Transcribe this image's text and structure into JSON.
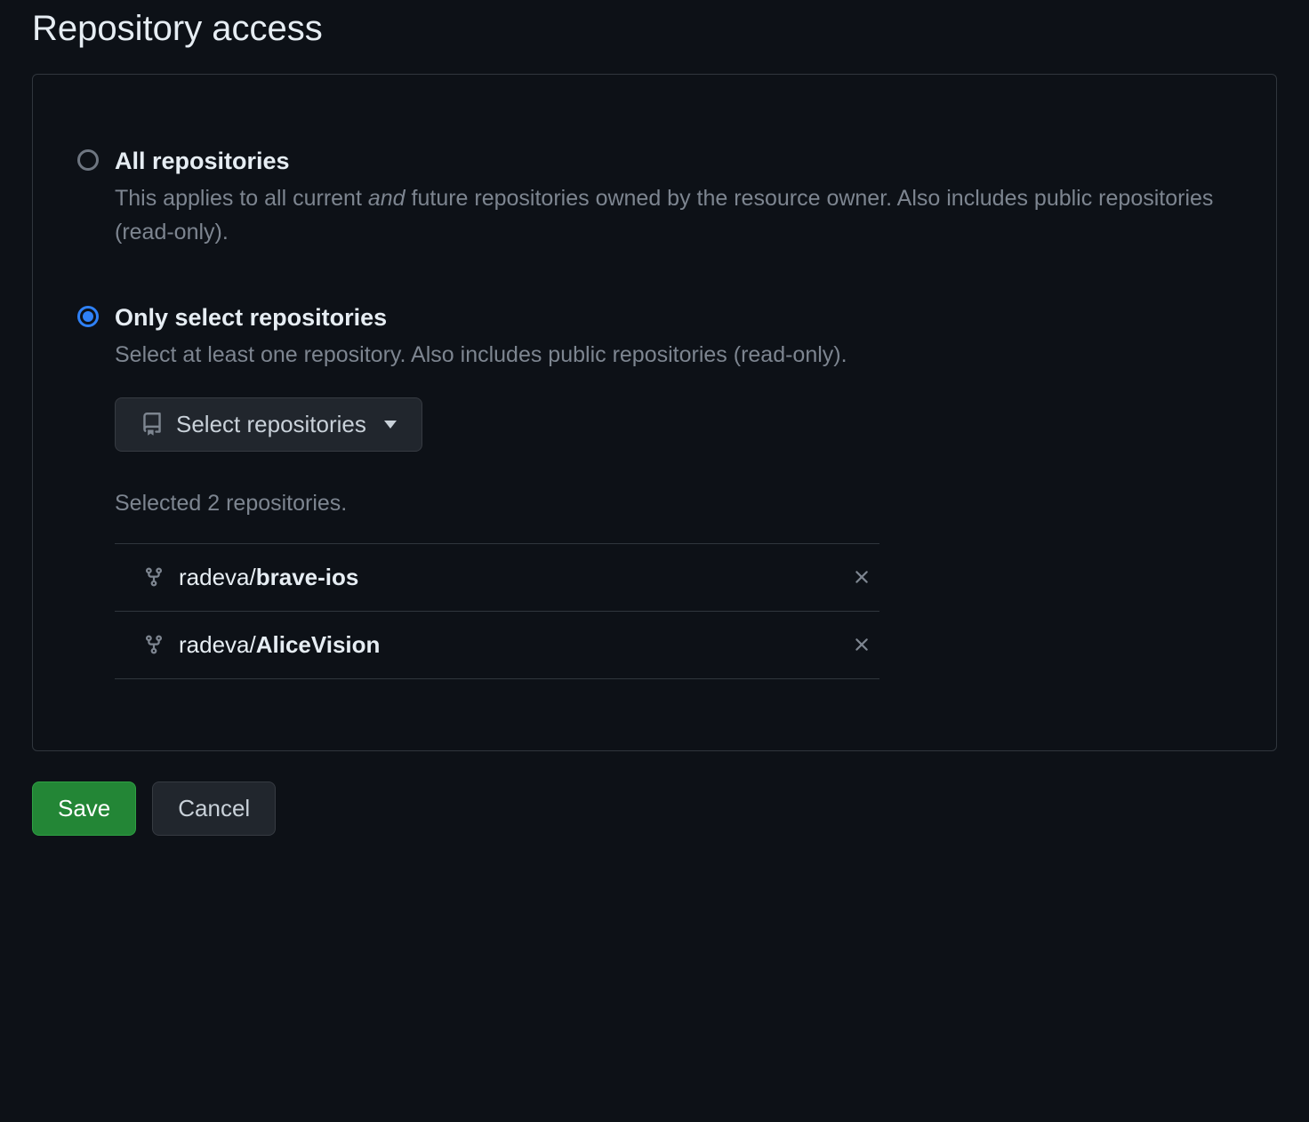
{
  "title": "Repository access",
  "options": {
    "all": {
      "label": "All repositories",
      "desc_before": "This applies to all current ",
      "desc_em": "and",
      "desc_after": " future repositories owned by the resource owner. Also includes public repositories (read-only)."
    },
    "select": {
      "label": "Only select repositories",
      "desc": "Select at least one repository. Also includes public repositories (read-only).",
      "button_label": "Select repositories",
      "selected_text": "Selected 2 repositories."
    }
  },
  "repos": [
    {
      "owner": "radeva/",
      "name": "brave-ios"
    },
    {
      "owner": "radeva/",
      "name": "AliceVision"
    }
  ],
  "buttons": {
    "save": "Save",
    "cancel": "Cancel"
  }
}
